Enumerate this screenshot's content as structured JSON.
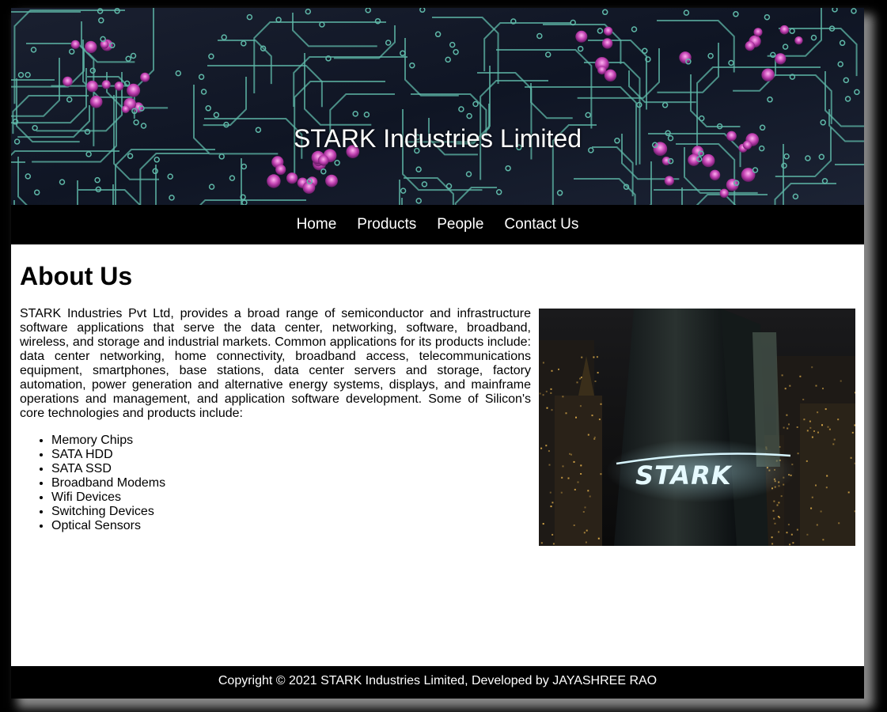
{
  "header": {
    "site_title": "STARK Industries Limited"
  },
  "nav": {
    "items": [
      {
        "label": "Home"
      },
      {
        "label": "Products"
      },
      {
        "label": "People"
      },
      {
        "label": "Contact Us"
      }
    ]
  },
  "main": {
    "heading": "About Us",
    "paragraph": "STARK Industries Pvt Ltd, provides a broad range of semiconductor and infrastructure software applications that serve the data center, networking, software, broadband, wireless, and storage and industrial markets. Common applications for its products include: data center networking, home connectivity, broadband access, telecommunications equipment, smartphones, base stations, data center servers and storage, factory automation, power generation and alternative energy systems, displays, and mainframe operations and management, and application software development. Some of Silicon's core technologies and products include:",
    "products": [
      "Memory Chips",
      "SATA HDD",
      "SATA SSD",
      "Broadband Modems",
      "Wifi Devices",
      "Switching Devices",
      "Optical Sensors"
    ],
    "image_sign_text": "STARK"
  },
  "footer": {
    "copyright": "Copyright © 2021 STARK Industries Limited, Developed by JAYASHREE RAO"
  },
  "colors": {
    "page_bg": "#ffffff",
    "frame_bg": "#000000",
    "nav_bg": "#000000",
    "footer_bg": "#000000",
    "circuit_trace": "#5fb8a8",
    "circuit_pad": "#c040b0"
  }
}
